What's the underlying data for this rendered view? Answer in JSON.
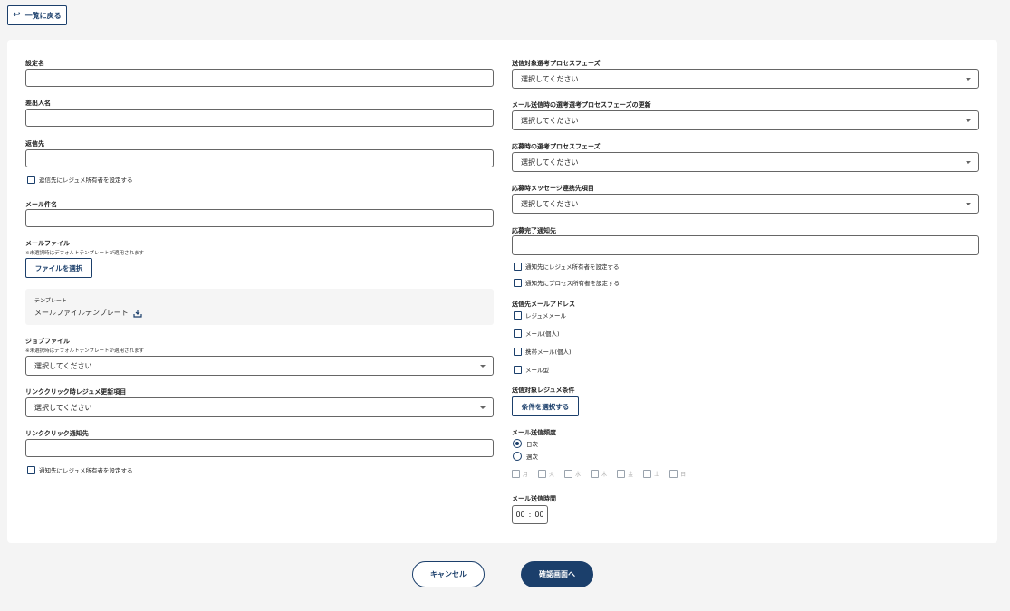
{
  "header": {
    "back_label": "一覧に戻る"
  },
  "left": {
    "setting_name": {
      "label": "設定名",
      "value": ""
    },
    "sender_name": {
      "label": "差出人名",
      "value": ""
    },
    "reply_to": {
      "label": "返信先",
      "value": "",
      "checkbox": "返信先にレジュメ所有者を設定する"
    },
    "subject": {
      "label": "メール件名",
      "value": ""
    },
    "mail_file": {
      "label": "メールファイル",
      "note": "※未選択時はデフォルトテンプレートが適用されます",
      "button": "ファイルを選択"
    },
    "template": {
      "label": "テンプレート",
      "link": "メールファイルテンプレート"
    },
    "job_file": {
      "label": "ジョブファイル",
      "note": "※未選択時はデフォルトテンプレートが適用されます",
      "selected": "選択してください"
    },
    "link_update": {
      "label": "リンククリック時レジュメ更新項目",
      "selected": "選択してください"
    },
    "link_notify": {
      "label": "リンククリック通知先",
      "value": "",
      "checkbox": "通知先にレジュメ所有者を設定する"
    }
  },
  "right": {
    "target_phase": {
      "label": "送信対象選考プロセスフェーズ",
      "selected": "選択してください"
    },
    "update_phase": {
      "label": "メール送信時の選考選考プロセスフェーズの更新",
      "selected": "選択してください"
    },
    "apply_phase": {
      "label": "応募時の選考プロセスフェーズ",
      "selected": "選択してください"
    },
    "apply_message": {
      "label": "応募時メッセージ連携先項目",
      "selected": "選択してください"
    },
    "apply_notify": {
      "label": "応募完了通知先",
      "value": "",
      "checkbox_owner": "通知先にレジュメ所有者を設定する",
      "checkbox_process": "通知先にプロセス所有者を設定する"
    },
    "address": {
      "label": "送信先メールアドレス",
      "options": [
        "レジュメメール",
        "メール(個人)",
        "携帯メール(個人)",
        "メール型"
      ]
    },
    "condition": {
      "label": "送信対象レジュメ条件",
      "button": "条件を選択する"
    },
    "frequency": {
      "label": "メール送信頻度",
      "options": [
        "日次",
        "週次"
      ],
      "selected": "日次",
      "days": [
        "月",
        "火",
        "水",
        "木",
        "金",
        "土",
        "日"
      ]
    },
    "time": {
      "label": "メール送信時間",
      "hour": "00",
      "sep": ":",
      "minute": "00"
    }
  },
  "footer": {
    "cancel_label": "キャンセル",
    "confirm_label": "確認画面へ"
  },
  "colors": {
    "primary": "#1b3f6b",
    "background": "#f4f4f4",
    "card": "#ffffff"
  }
}
